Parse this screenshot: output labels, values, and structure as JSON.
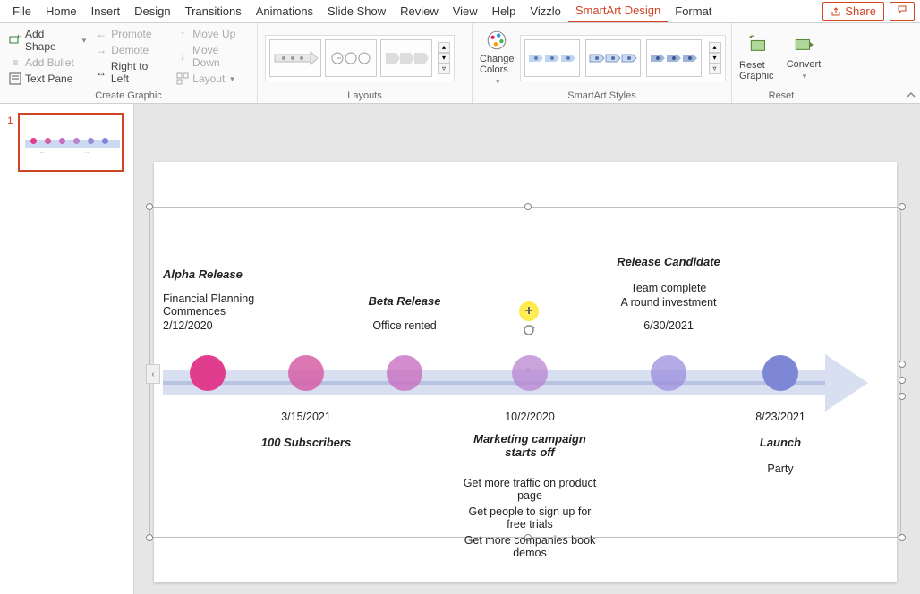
{
  "tabs": {
    "file": "File",
    "home": "Home",
    "insert": "Insert",
    "design": "Design",
    "transitions": "Transitions",
    "animations": "Animations",
    "slideshow": "Slide Show",
    "review": "Review",
    "view": "View",
    "help": "Help",
    "vizzlo": "Vizzlo",
    "smartart": "SmartArt Design",
    "format": "Format",
    "share": "Share"
  },
  "ribbon": {
    "create": {
      "add_shape": "Add Shape",
      "add_bullet": "Add Bullet",
      "text_pane": "Text Pane",
      "promote": "Promote",
      "demote": "Demote",
      "rtl": "Right to Left",
      "move_up": "Move Up",
      "move_down": "Move Down",
      "layout": "Layout",
      "group_label": "Create Graphic"
    },
    "layouts_label": "Layouts",
    "change_colors": "Change Colors",
    "styles_label": "SmartArt Styles",
    "reset_graphic": "Reset Graphic",
    "convert": "Convert",
    "reset_label": "Reset"
  },
  "thumb_number": "1",
  "timeline": {
    "n0": {
      "title": "Alpha Release",
      "sub1": "Financial Planning Commences",
      "sub2": "2/12/2020",
      "color": "#E13D8F"
    },
    "n1": {
      "date": "3/15/2021",
      "title": "100 Subscribers",
      "color": "#D65FA6"
    },
    "n2": {
      "title": "Beta Release",
      "sub1": "Office rented",
      "color": "#C86FC0"
    },
    "n3": {
      "date": "10/2/2020",
      "title": "Marketing campaign starts off",
      "b1": "Get more traffic on product page",
      "b2": "Get people to sign up for free trials",
      "b3": "Get more companies book demos",
      "color": "#B884D1"
    },
    "n4": {
      "title": "Release Candidate",
      "sub1": "Team complete",
      "sub2": "A round investment",
      "sub3": "6/30/2021",
      "color": "#9B8DDC"
    },
    "n5": {
      "date": "8/23/2021",
      "title": "Launch",
      "sub1": "Party",
      "color": "#7E86D6"
    }
  }
}
